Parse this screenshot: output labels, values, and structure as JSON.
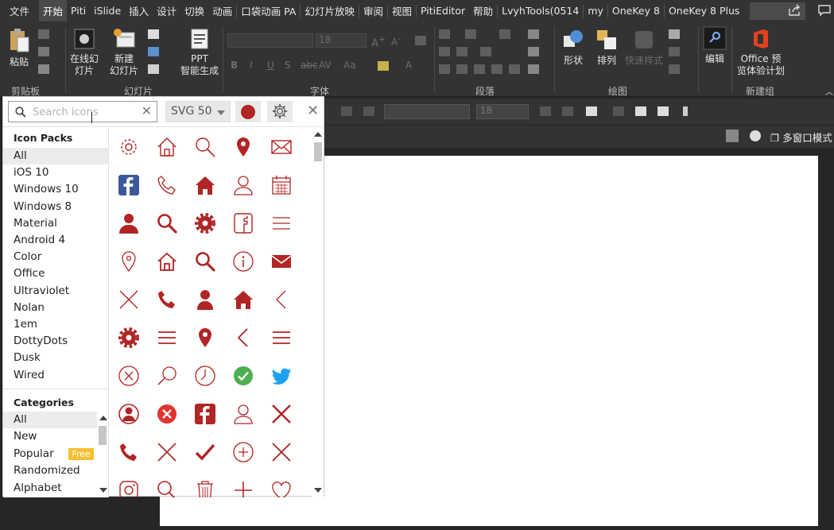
{
  "menubar": {
    "tabs": [
      "文件",
      "开始",
      "Piti",
      "iSlide",
      "插入",
      "设计",
      "切换",
      "动画",
      "口袋动画 PA",
      "幻灯片放映",
      "审阅",
      "视图",
      "PitiEditor",
      "帮助",
      "LvyhTools(0514",
      "my",
      "OneKey 8",
      "OneKey 8 Plus"
    ],
    "active": "开始"
  },
  "ribbon": {
    "paste": "粘贴",
    "online_slide_1": "在线幻",
    "online_slide_2": "灯片",
    "new_slide_1": "新建",
    "new_slide_2": "幻灯片",
    "ppt_gen_1": "PPT",
    "ppt_gen_2": "智能生成",
    "shape": "形状",
    "arrange": "排列",
    "quick_style": "快速样式",
    "edit": "编辑",
    "office_1": "Office 预",
    "office_2": "览体验计划",
    "groups": {
      "clipboard": "剪贴板",
      "slides": "幻灯片",
      "font": "字体",
      "paragraph": "段落",
      "drawing": "绘图",
      "new_group": "新建组"
    },
    "font_size": "18"
  },
  "toolbar2": {
    "font_size": "18"
  },
  "multi_window": "多窗口模式",
  "panel": {
    "search_placeholder": "Search icons",
    "format": "SVG 50",
    "accent_color": "#b02525",
    "icon_packs_header": "Icon Packs",
    "icon_packs": [
      "All",
      "iOS 10",
      "Windows 10",
      "Windows 8",
      "Material",
      "Android 4",
      "Color",
      "Office",
      "Ultraviolet",
      "Nolan",
      "1em",
      "DottyDots",
      "Dusk",
      "Wired"
    ],
    "categories_header": "Categories",
    "categories": [
      "All",
      "New",
      "Popular",
      "Randomized",
      "Alphabet"
    ],
    "free_badge": "Free",
    "icons": [
      [
        "settings-outline",
        "home-outline",
        "search-outline",
        "map-pin-filled",
        "mail-outline"
      ],
      [
        "facebook-filled",
        "phone-outline",
        "home-filled",
        "user-outline",
        "calendar-outline"
      ],
      [
        "user-filled",
        "search-bold",
        "settings-filled",
        "facebook-outline",
        "menu-thin"
      ],
      [
        "map-pin-outline",
        "home-outline-2",
        "search-bold-2",
        "info-outline",
        "mail-filled"
      ],
      [
        "close-thin",
        "phone-filled",
        "user-filled-2",
        "home-filled-2",
        "chevron-left"
      ],
      [
        "settings-filled-2",
        "menu",
        "map-pin-filled-2",
        "chevron-left-2",
        "menu-2"
      ],
      [
        "close-circle-outline",
        "search-thin",
        "clock-outline",
        "checkmark-circle-green",
        "twitter-bird"
      ],
      [
        "user-circle-filled",
        "close-circle-filled",
        "facebook-square-filled",
        "user-outline-2",
        "close-bold"
      ],
      [
        "phone-filled-2",
        "close-thin-2",
        "checkmark",
        "plus-circle-outline",
        "close-thin-3"
      ],
      [
        "instagram-outline",
        "search-outline-2",
        "trash-outline",
        "plus",
        "heart-outline"
      ]
    ]
  }
}
